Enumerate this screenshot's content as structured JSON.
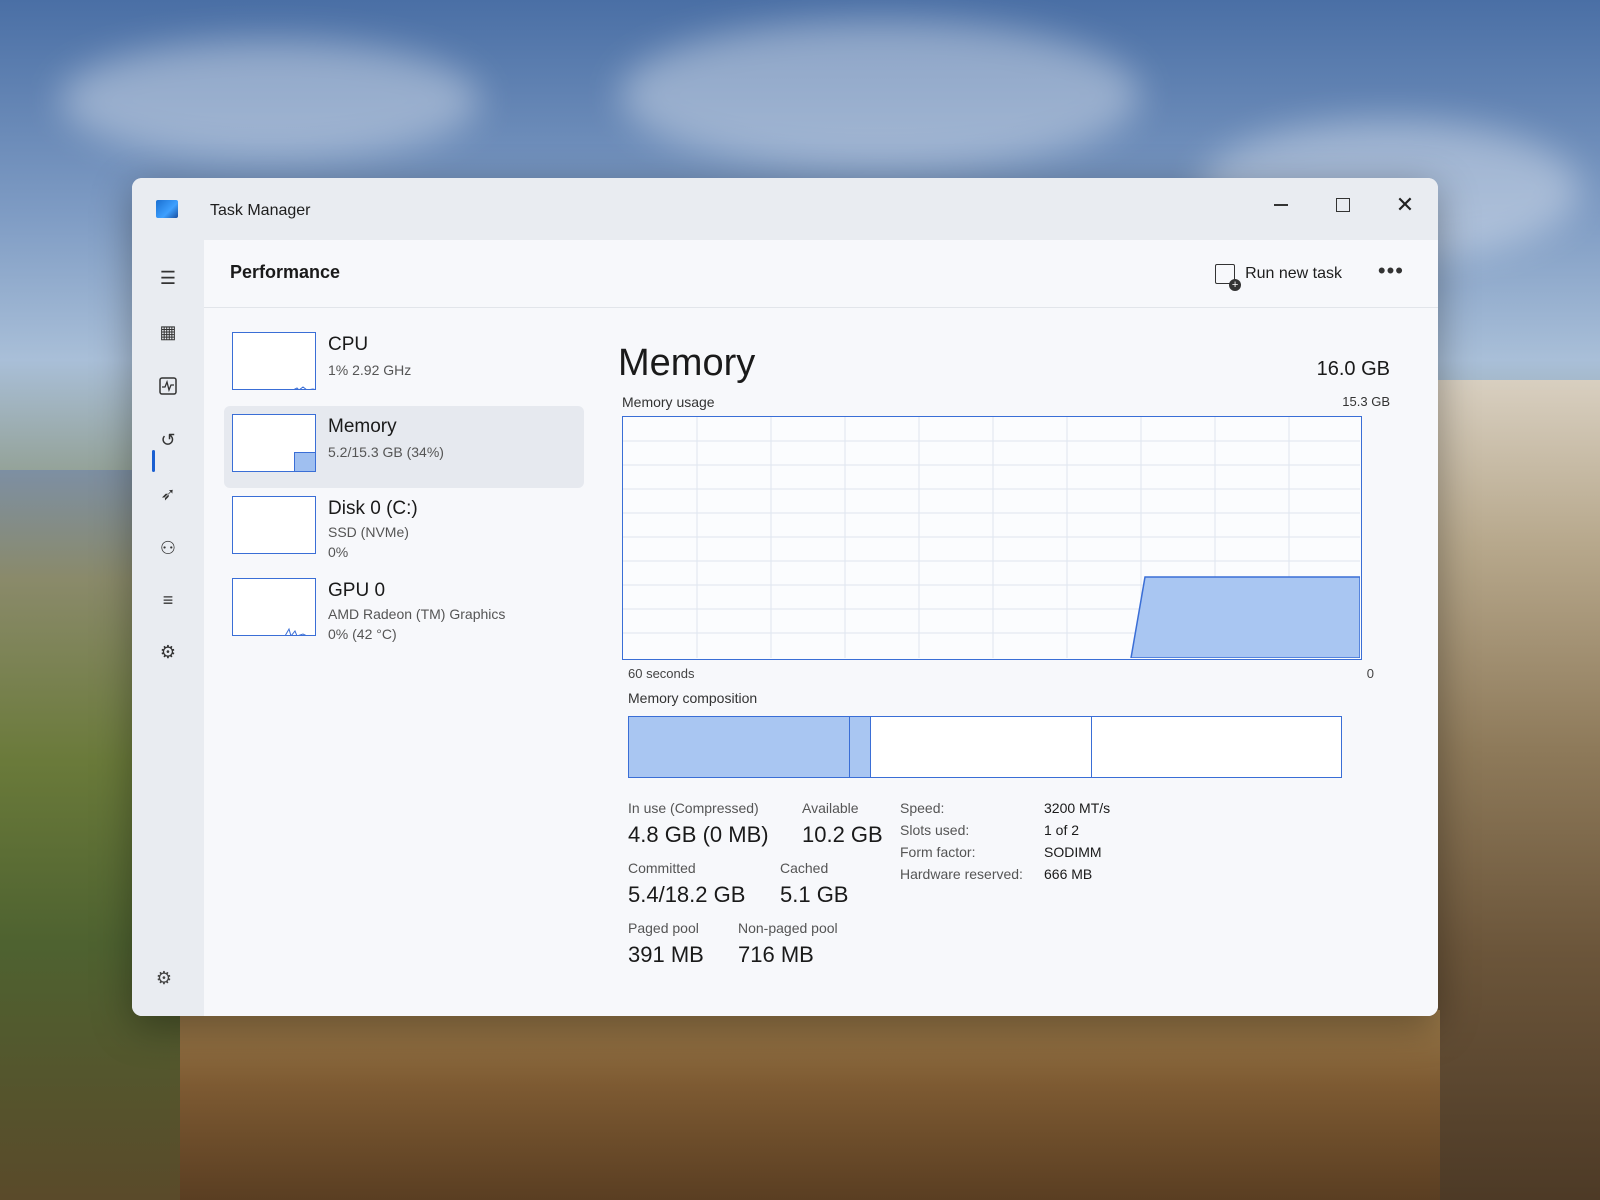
{
  "window": {
    "title": "Task Manager"
  },
  "header": {
    "page_title": "Performance",
    "run_new_task": "Run new task",
    "more": "•••"
  },
  "devices": [
    {
      "name": "CPU",
      "line1": "1% 2.92 GHz",
      "line2": ""
    },
    {
      "name": "Memory",
      "line1": "5.2/15.3 GB (34%)",
      "line2": ""
    },
    {
      "name": "Disk 0 (C:)",
      "line1": "SSD (NVMe)",
      "line2": "0%"
    },
    {
      "name": "GPU 0",
      "line1": "AMD Radeon (TM) Graphics",
      "line2": "0% (42 °C)"
    }
  ],
  "memory": {
    "title": "Memory",
    "total": "16.0 GB",
    "usage_label": "Memory usage",
    "usage_max": "15.3 GB",
    "time_label": "60 seconds",
    "zero_label": "0",
    "composition_label": "Memory composition",
    "composition": {
      "in_use_fraction": 0.31,
      "modified_fraction": 0.03,
      "standby_fraction": 0.31
    },
    "usage_fraction": 0.34,
    "stats": {
      "in_use_label": "In use (Compressed)",
      "in_use_value": "4.8 GB (0 MB)",
      "available_label": "Available",
      "available_value": "10.2 GB",
      "committed_label": "Committed",
      "committed_value": "5.4/18.2 GB",
      "cached_label": "Cached",
      "cached_value": "5.1 GB",
      "paged_label": "Paged pool",
      "paged_value": "391 MB",
      "nonpaged_label": "Non-paged pool",
      "nonpaged_value": "716 MB"
    },
    "specs": {
      "speed_label": "Speed:",
      "speed_value": "3200 MT/s",
      "slots_label": "Slots used:",
      "slots_value": "1 of 2",
      "form_label": "Form factor:",
      "form_value": "SODIMM",
      "hw_label": "Hardware reserved:",
      "hw_value": "666 MB"
    }
  },
  "colors": {
    "accent": "#3a6ed6",
    "fill": "#a9c6f2"
  }
}
